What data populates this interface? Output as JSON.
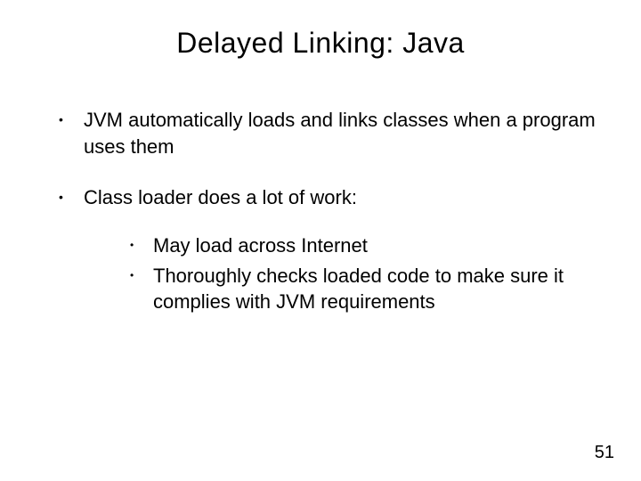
{
  "title": "Delayed Linking: Java",
  "bullets": [
    {
      "text": "JVM automatically loads and links classes when a program uses them"
    },
    {
      "text": "Class loader does a lot of work:",
      "children": [
        "May load across Internet",
        "Thoroughly checks loaded code to make sure it complies with JVM requirements"
      ]
    }
  ],
  "page_number": "51"
}
